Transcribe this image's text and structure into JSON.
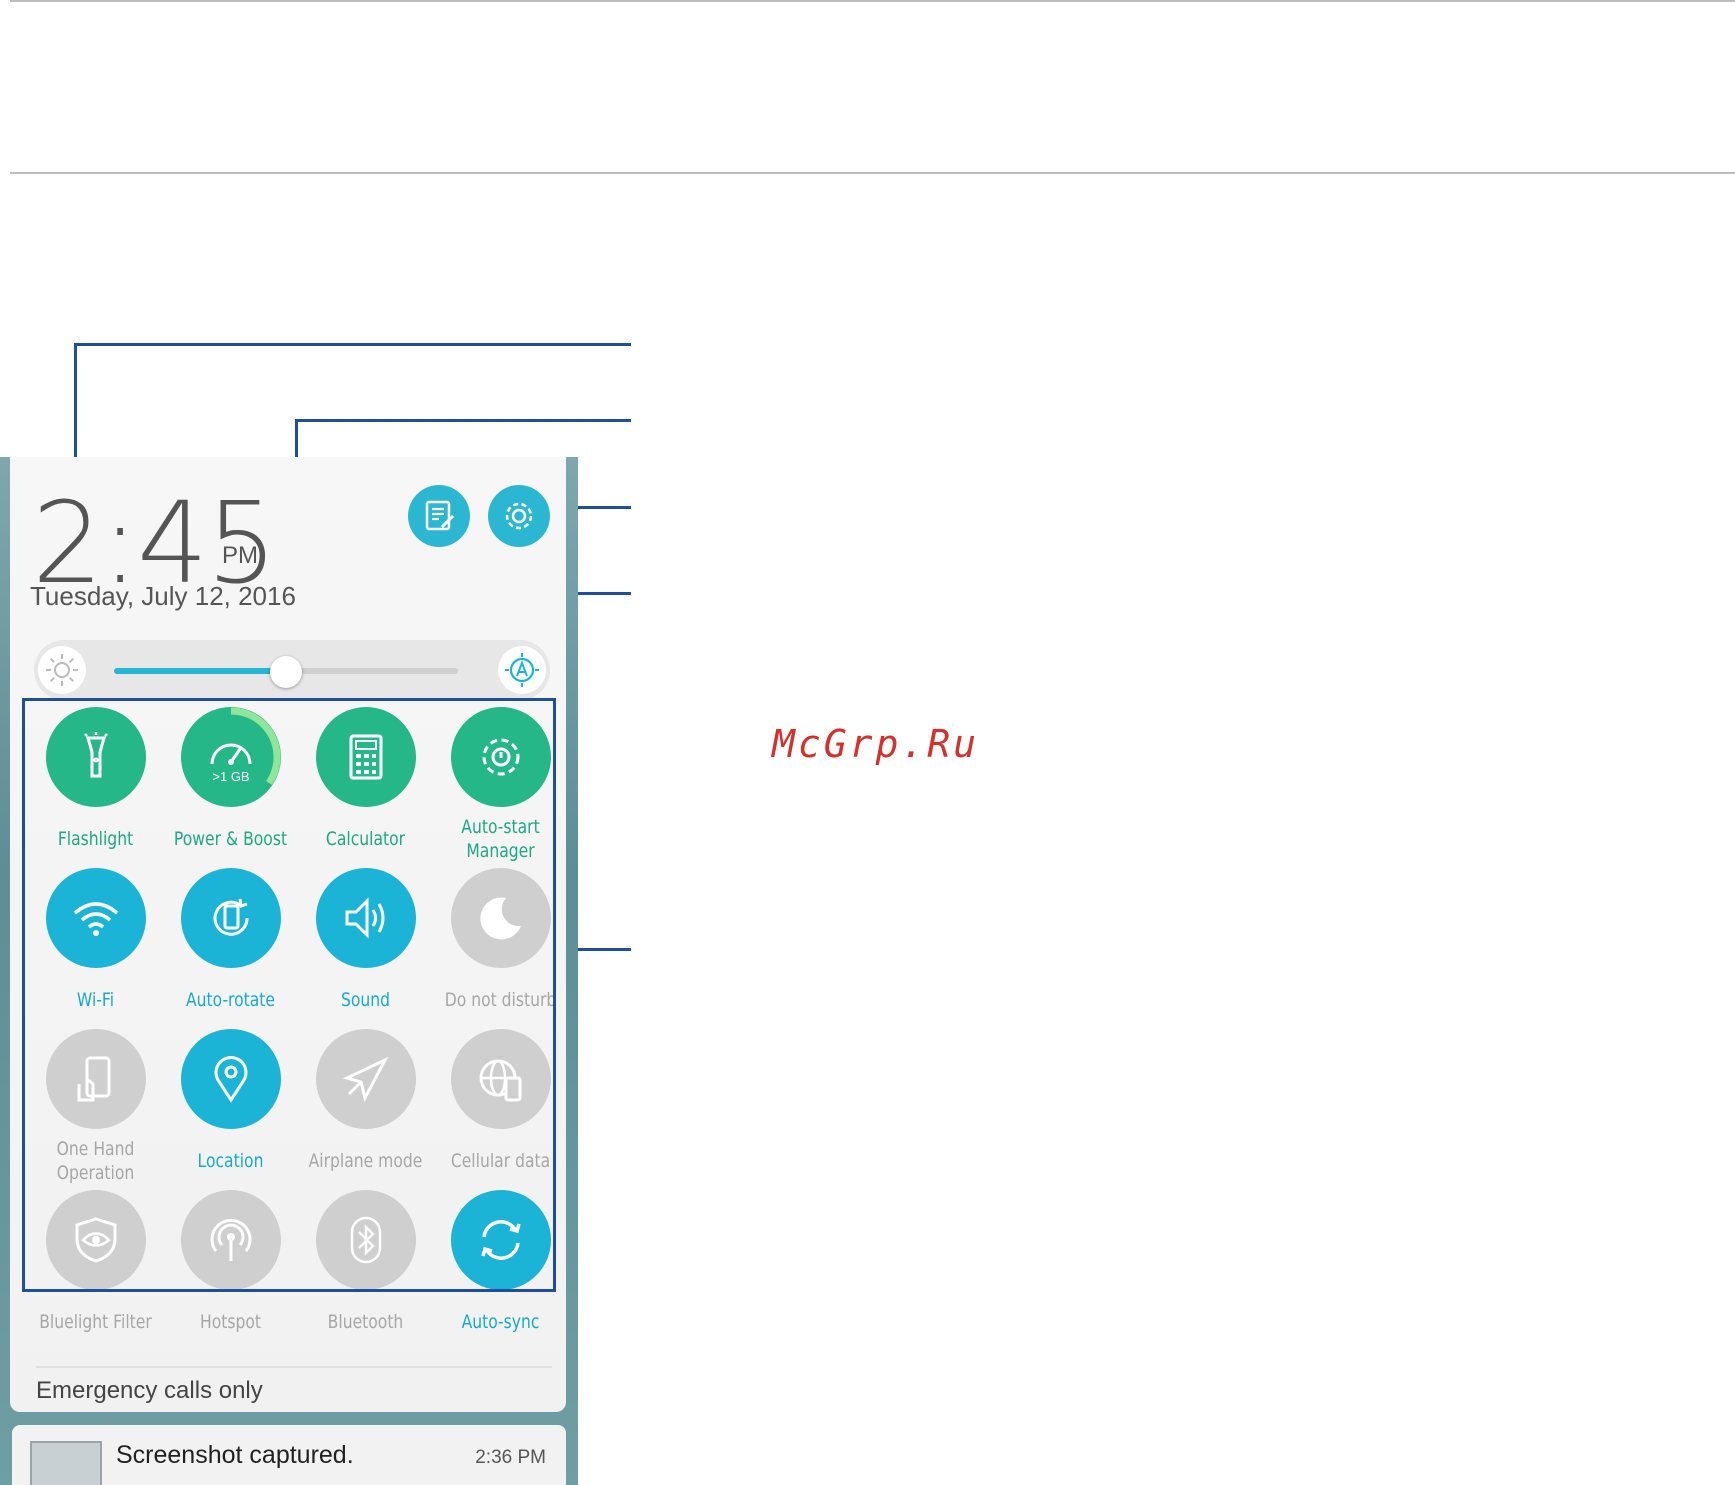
{
  "watermark": "McGrp.Ru",
  "clock": {
    "time": "2:45",
    "ampm": "PM",
    "date": "Tuesday, July 12, 2016"
  },
  "brightness": {
    "level": 0.5
  },
  "quick_settings": [
    {
      "label": "Flashlight",
      "state": "on-green",
      "icon": "flashlight-icon"
    },
    {
      "label": "Power & Boost",
      "state": "on-green",
      "icon": "speedometer-icon",
      "badge": ">1 GB"
    },
    {
      "label": "Calculator",
      "state": "on-green",
      "icon": "calculator-icon"
    },
    {
      "label": "Auto-start Manager",
      "state": "on-green",
      "icon": "gear-icon"
    },
    {
      "label": "Wi-Fi",
      "state": "on-blue",
      "icon": "wifi-icon"
    },
    {
      "label": "Auto-rotate",
      "state": "on-blue",
      "icon": "rotate-icon"
    },
    {
      "label": "Sound",
      "state": "on-blue",
      "icon": "speaker-icon"
    },
    {
      "label": "Do not disturb",
      "state": "off",
      "icon": "moon-icon"
    },
    {
      "label": "One Hand Operation",
      "state": "off",
      "icon": "one-hand-icon"
    },
    {
      "label": "Location",
      "state": "on-blue",
      "icon": "location-pin-icon"
    },
    {
      "label": "Airplane mode",
      "state": "off",
      "icon": "airplane-icon"
    },
    {
      "label": "Cellular data",
      "state": "off",
      "icon": "globe-phone-icon"
    },
    {
      "label": "Bluelight Filter",
      "state": "off",
      "icon": "eye-shield-icon"
    },
    {
      "label": "Hotspot",
      "state": "off",
      "icon": "hotspot-icon"
    },
    {
      "label": "Bluetooth",
      "state": "off",
      "icon": "bluetooth-icon"
    },
    {
      "label": "Auto-sync",
      "state": "on-blue",
      "icon": "sync-icon"
    }
  ],
  "footer": {
    "emergency": "Emergency calls only"
  },
  "notification": {
    "title": "Screenshot captured.",
    "time": "2:36 PM"
  },
  "colors": {
    "accent_blue": "#1bb3d6",
    "accent_green": "#25b788",
    "callout": "#1f4e9e",
    "off_gray": "#cfcfcf"
  }
}
